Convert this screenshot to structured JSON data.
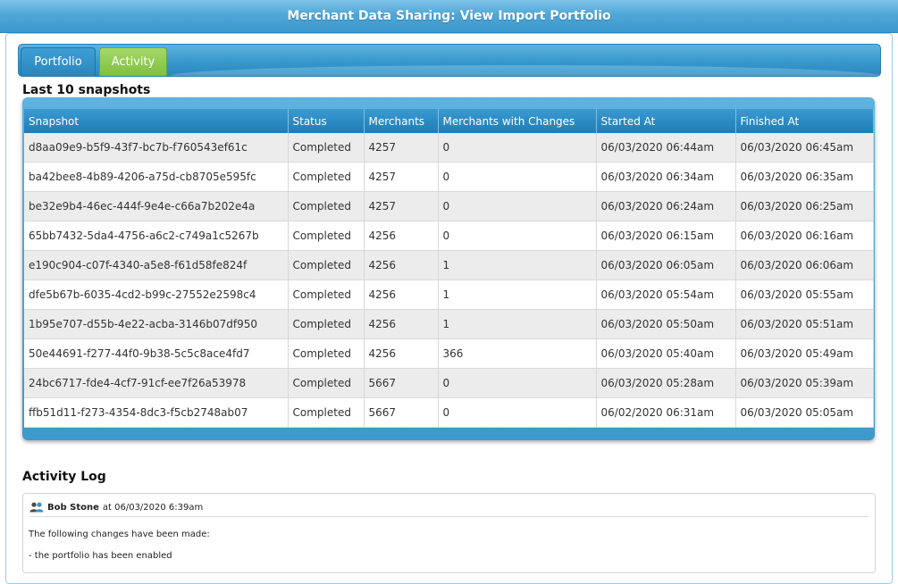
{
  "title": "Merchant Data Sharing: View Import Portfolio",
  "tabs": [
    {
      "label": "Portfolio",
      "active": false
    },
    {
      "label": "Activity",
      "active": true
    }
  ],
  "snapshots": {
    "heading": "Last 10 snapshots",
    "columns": [
      "Snapshot",
      "Status",
      "Merchants",
      "Merchants with Changes",
      "Started At",
      "Finished At"
    ],
    "rows": [
      [
        "d8aa09e9-b5f9-43f7-bc7b-f760543ef61c",
        "Completed",
        "4257",
        "0",
        "06/03/2020 06:44am",
        "06/03/2020 06:45am"
      ],
      [
        "ba42bee8-4b89-4206-a75d-cb8705e595fc",
        "Completed",
        "4257",
        "0",
        "06/03/2020 06:34am",
        "06/03/2020 06:35am"
      ],
      [
        "be32e9b4-46ec-444f-9e4e-c66a7b202e4a",
        "Completed",
        "4257",
        "0",
        "06/03/2020 06:24am",
        "06/03/2020 06:25am"
      ],
      [
        "65bb7432-5da4-4756-a6c2-c749a1c5267b",
        "Completed",
        "4256",
        "0",
        "06/03/2020 06:15am",
        "06/03/2020 06:16am"
      ],
      [
        "e190c904-c07f-4340-a5e8-f61d58fe824f",
        "Completed",
        "4256",
        "1",
        "06/03/2020 06:05am",
        "06/03/2020 06:06am"
      ],
      [
        "dfe5b67b-6035-4cd2-b99c-27552e2598c4",
        "Completed",
        "4256",
        "1",
        "06/03/2020 05:54am",
        "06/03/2020 05:55am"
      ],
      [
        "1b95e707-d55b-4e22-acba-3146b07df950",
        "Completed",
        "4256",
        "1",
        "06/03/2020 05:50am",
        "06/03/2020 05:51am"
      ],
      [
        "50e44691-f277-44f0-9b38-5c5c8ace4fd7",
        "Completed",
        "4256",
        "366",
        "06/03/2020 05:40am",
        "06/03/2020 05:49am"
      ],
      [
        "24bc6717-fde4-4cf7-91cf-ee7f26a53978",
        "Completed",
        "5667",
        "0",
        "06/03/2020 05:28am",
        "06/03/2020 05:39am"
      ],
      [
        "ffb51d11-f273-4354-8dc3-f5cb2748ab07",
        "Completed",
        "5667",
        "0",
        "06/02/2020 06:31am",
        "06/03/2020 05:05am"
      ]
    ]
  },
  "activity_log": {
    "heading": "Activity Log",
    "entries": [
      {
        "icon": "users-icon",
        "user": "Bob Stone",
        "at_text": "at 06/03/2020 6:39am",
        "lines": [
          "The following changes have been made:",
          "- the portfolio has been enabled"
        ]
      }
    ]
  },
  "colors": {
    "header_blue": "#3b98cc",
    "active_tab_green": "#7fbf3f",
    "row_alt": "#ececec"
  }
}
